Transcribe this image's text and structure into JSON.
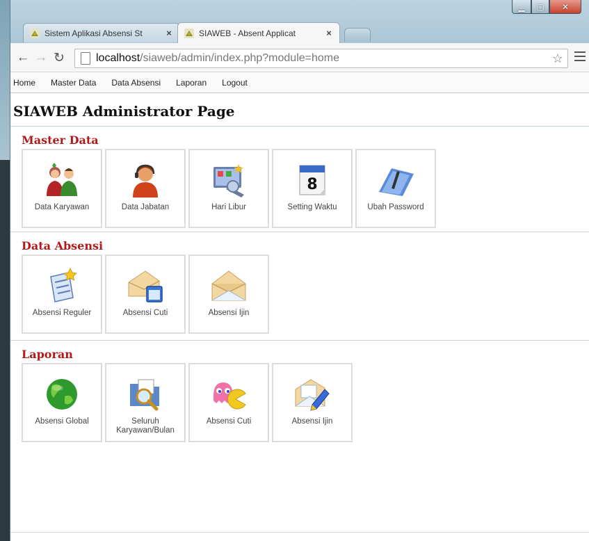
{
  "browser": {
    "tabs": [
      {
        "title": "Sistem Aplikasi Absensi St",
        "active": false
      },
      {
        "title": "SIAWEB - Absent Applicat",
        "active": true
      }
    ],
    "url_host": "localhost",
    "url_path": "/siaweb/admin/index.php?module=home"
  },
  "menu": {
    "items": [
      "Home",
      "Master Data",
      "Data Absensi",
      "Laporan",
      "Logout"
    ]
  },
  "page_title": "SIAWEB Administrator Page",
  "sections": [
    {
      "title": "Master Data",
      "tiles": [
        {
          "label": "Data Karyawan",
          "icon": "employees-icon"
        },
        {
          "label": "Data Jabatan",
          "icon": "support-agent-icon"
        },
        {
          "label": "Hari Libur",
          "icon": "holiday-monitor-icon"
        },
        {
          "label": "Setting Waktu",
          "icon": "calendar-icon"
        },
        {
          "label": "Ubah Password",
          "icon": "folder-key-icon"
        }
      ]
    },
    {
      "title": "Data Absensi",
      "tiles": [
        {
          "label": "Absensi Reguler",
          "icon": "document-star-icon"
        },
        {
          "label": "Absensi Cuti",
          "icon": "envelope-window-icon"
        },
        {
          "label": "Absensi Ijin",
          "icon": "envelope-icon"
        }
      ]
    },
    {
      "title": "Laporan",
      "tiles": [
        {
          "label": "Absensi Global",
          "icon": "globe-icon"
        },
        {
          "label": "Seluruh Karyawan/Bulan",
          "icon": "folder-search-icon"
        },
        {
          "label": "Absensi Cuti",
          "icon": "pacman-icon"
        },
        {
          "label": "Absensi Ijin",
          "icon": "envelope-pencil-icon"
        }
      ]
    }
  ],
  "colors": {
    "section_title": "#b11a1a",
    "tile_border": "#dcdcdc"
  }
}
